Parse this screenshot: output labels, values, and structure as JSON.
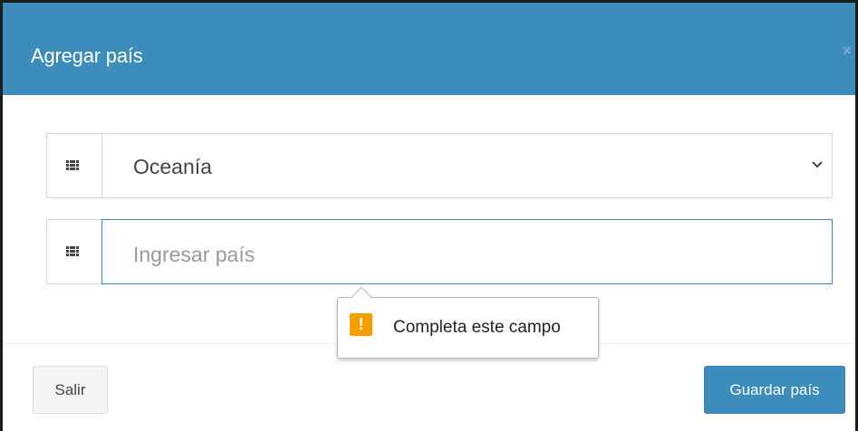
{
  "modal": {
    "title": "Agregar país",
    "close_glyph": "×"
  },
  "form": {
    "continent_select": {
      "selected": "Oceanía",
      "icon": "th-grid-icon"
    },
    "country_input": {
      "value": "",
      "placeholder": "Ingresar país",
      "icon": "th-grid-icon"
    }
  },
  "validation_tooltip": {
    "icon_glyph": "!",
    "message": "Completa este campo"
  },
  "footer": {
    "exit_label": "Salir",
    "save_label": "Guardar país"
  },
  "colors": {
    "header": "#3c8dbc",
    "primary_button": "#3c8dbc",
    "warning": "#f5a000"
  }
}
